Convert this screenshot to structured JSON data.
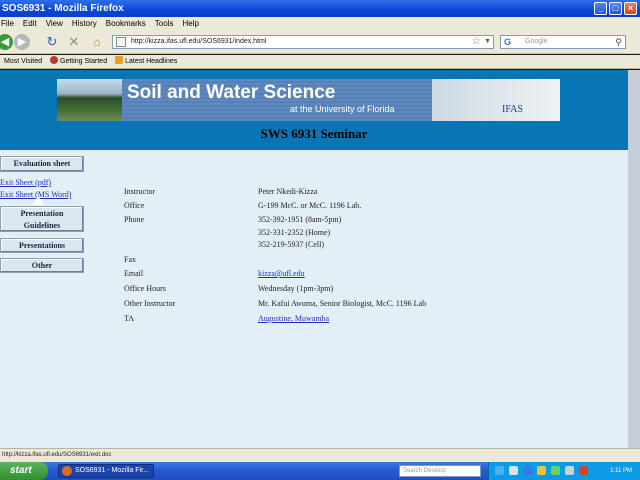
{
  "window": {
    "title": "SOS6931 - Mozilla Firefox"
  },
  "menu": [
    "File",
    "Edit",
    "View",
    "History",
    "Bookmarks",
    "Tools",
    "Help"
  ],
  "toolbar": {
    "url": "http://kizza.ifas.ufl.edu/SOS6931/index.html",
    "search_placeholder": "Google"
  },
  "bookmarks": [
    "Most Visited",
    "Getting Started",
    "Latest Headlines"
  ],
  "banner": {
    "title": "Soil and Water Science",
    "subtitle": "at the University of Florida",
    "logo_text": "IFAS"
  },
  "page_heading": "SWS 6931 Seminar",
  "sidebar": {
    "evaluation": "Evaluation sheet",
    "links": [
      "Exit Sheet (pdf)",
      "Exit Sheet (MS Word)"
    ],
    "presentation_guidelines": [
      "Presentation",
      "Guidelines"
    ],
    "presentations": "Presentations",
    "other": "Other"
  },
  "info": {
    "instructor_label": "Instructor",
    "instructor": "Peter Nkedi-Kizza",
    "office_label": "Office",
    "office": "G-199 McC.  or McC. 1196 Lab.",
    "phone_label": "Phone",
    "phones": [
      "352-392-1951 (8am-5pm)",
      "352-331-2352 (Home)",
      "352-219-5937 (Cell)"
    ],
    "fax_label": "Fax",
    "email_label": "Email",
    "email": "kizza@ufl.edu",
    "hours_label": "Office Hours",
    "hours": "Wednesday (1pm-3pm)",
    "other_instructor_label": "Other Instructor",
    "other_instructor": "Mr. Kafui Awuma, Senior Biologist, McC. 1196 Lab",
    "ta_label": "TA",
    "ta": "Augustine, Muwamba"
  },
  "status": "http://kizza.ifas.ufl.edu/SOS6931/exit.doc",
  "taskbar": {
    "start": "start",
    "task": "SOS6931 - Mozilla Fir...",
    "search_placeholder": "Search Desktop",
    "clock": "1:11 PM"
  },
  "colors": {
    "banner_blue": "#0875b5",
    "page_bg": "#e3eff6",
    "link": "#1f2fbf"
  }
}
